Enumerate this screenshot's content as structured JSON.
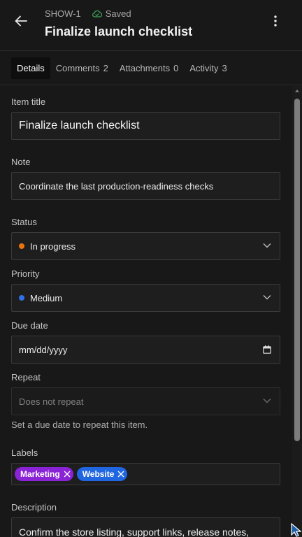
{
  "header": {
    "item_id": "SHOW-1",
    "saved_label": "Saved",
    "title": "Finalize launch checklist"
  },
  "tabs": [
    {
      "label": "Details",
      "count": ""
    },
    {
      "label": "Comments",
      "count": "2"
    },
    {
      "label": "Attachments",
      "count": "0"
    },
    {
      "label": "Activity",
      "count": "3"
    }
  ],
  "form": {
    "item_title": {
      "label": "Item title",
      "value": "Finalize launch checklist"
    },
    "note": {
      "label": "Note",
      "value": "Coordinate the last production-readiness checks"
    },
    "status": {
      "label": "Status",
      "value": "In progress",
      "color": "#e8740c"
    },
    "priority": {
      "label": "Priority",
      "value": "Medium",
      "color": "#2f6fe8"
    },
    "due_date": {
      "label": "Due date",
      "value": "mm/dd/yyyy"
    },
    "repeat": {
      "label": "Repeat",
      "value": "Does not repeat",
      "hint": "Set a due date to repeat this item."
    },
    "labels": {
      "label": "Labels",
      "items": [
        {
          "name": "Marketing",
          "color": "#8a22d6"
        },
        {
          "name": "Website",
          "color": "#1f66e0"
        }
      ]
    },
    "description": {
      "label": "Description",
      "value": "Confirm the store listing, support links, release notes,"
    }
  },
  "colors": {
    "saved_icon": "#3fa35b",
    "background": "#181818"
  }
}
